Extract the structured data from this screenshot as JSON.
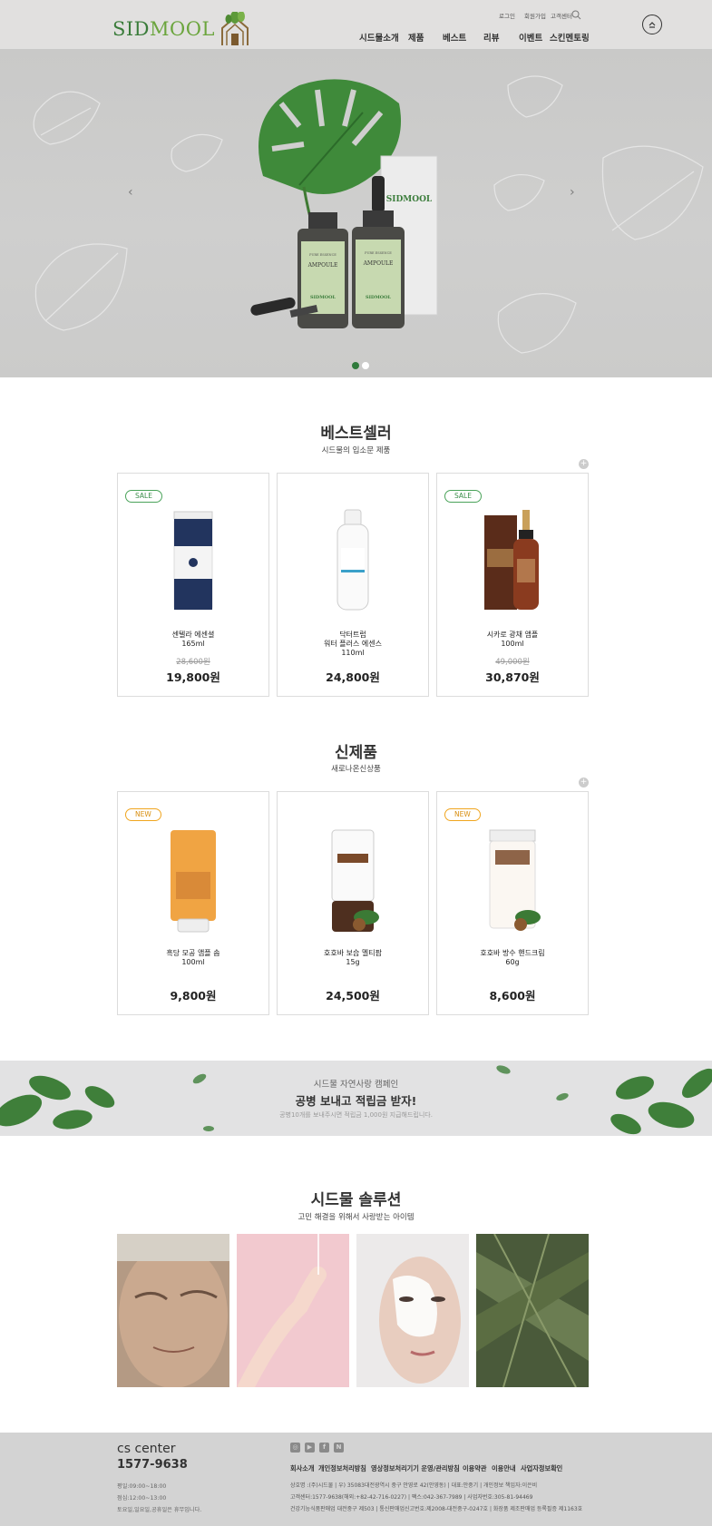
{
  "header": {
    "logo_sid": "SID",
    "logo_mool": "MOOL",
    "util_links": [
      "로그인",
      "회원가입",
      "고객센터"
    ],
    "nav": [
      "시드물소개",
      "제품",
      "베스트",
      "리뷰",
      "이벤트",
      "스킨멘토링"
    ]
  },
  "hero": {
    "bottle_label_top": "PURE ESSENCE",
    "bottle_label": "AMPOULE",
    "bottle_brand": "SIDMOOL",
    "box_brand": "SIDMOOL",
    "prev": "‹",
    "next": "›"
  },
  "bestseller": {
    "title": "베스트셀러",
    "subtitle": "시드물의 입소문 제품",
    "plus": "+",
    "products": [
      {
        "badge": "SALE",
        "name": "센텔라 에센셜\n165ml",
        "old_price": "28,600원",
        "price": "19,800원"
      },
      {
        "badge": "",
        "name": "닥터트럽\n워터 플러스 에센스\n110ml",
        "old_price": "",
        "price": "24,800원"
      },
      {
        "badge": "SALE",
        "name": "시카로 광채 앰플\n100ml",
        "old_price": "49,000원",
        "price": "30,870원"
      }
    ]
  },
  "newitems": {
    "title": "신제품",
    "subtitle": "새로나온신상품",
    "plus": "+",
    "products": [
      {
        "badge": "NEW",
        "name": "흑당 모공 앰플 솝\n100ml",
        "old_price": "",
        "price": "9,800원"
      },
      {
        "badge": "",
        "name": "호호바 보습 멜티팜\n15g",
        "old_price": "",
        "price": "24,500원"
      },
      {
        "badge": "NEW",
        "name": "호호바 방수 핸드크림\n60g",
        "old_price": "",
        "price": "8,600원"
      }
    ]
  },
  "campaign": {
    "line1": "시드물 자연사랑 캠페인",
    "line2": "공병 보내고 적립금 받자!",
    "line3": "공병10개를 보내주시면 적립금 1,000원 지급해드립니다."
  },
  "solution": {
    "title": "시드물 솔루션",
    "subtitle": "고민 해결을 위해서 사랑받는 아이템"
  },
  "footer": {
    "cs_title": "cs center",
    "cs_phone": "1577-9638",
    "hours": [
      "평일:09:00~18:00",
      "점심:12:00~13:00",
      "토요일,일요일,공휴일은 휴무입니다."
    ],
    "links": [
      "회사소개",
      "개인정보처리방침",
      "영상정보처리기기 운영/관리방침",
      "이용약관",
      "이용안내",
      "사업자정보확인"
    ],
    "info": [
      "상호명 :(주)시드물  |  우) 35083대전광역시 중구 안영로 42(안영동)  |  대표:안중기  |  개인정보 책임자:이은비",
      "고객센터:1577-9638(해외:+82-42-716-0227)  |  팩스:042-367-7989  |  사업자번호:305-81-94469",
      "건강기능식품판매업 대전중구 제503  |  통신판매업신고번호:제2008-대전중구-0247호  |  화장품 제조판매업 등록필증 제1163호"
    ],
    "social": [
      "instagram-icon",
      "youtube-icon",
      "facebook-icon",
      "blog-icon"
    ]
  },
  "colors": {
    "brand_green": "#2f7a3b",
    "sale": "#3b8e4b",
    "new": "#d88e10"
  }
}
